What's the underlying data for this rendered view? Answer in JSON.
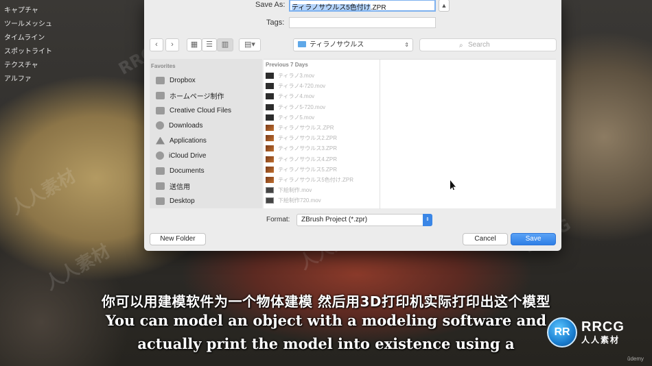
{
  "left_menu": {
    "items": [
      "キャプチャ",
      "ツールメッシュ",
      "タイムライン",
      "スポットライト",
      "テクスチャ",
      "アルファ"
    ]
  },
  "dialog": {
    "save_as_label": "Save As:",
    "save_as_selected": "ティラノサウルス5色付け",
    "save_as_ext": ".ZPR",
    "tags_label": "Tags:",
    "expand_icon": "chevron-up-icon",
    "location": "ティラノサウルス",
    "search_placeholder": "Search",
    "sidebar": {
      "heading": "Favorites",
      "items": [
        "Dropbox",
        "ホームページ制作",
        "Creative Cloud Files",
        "Downloads",
        "Applications",
        "iCloud Drive",
        "Documents",
        "送信用",
        "Desktop"
      ]
    },
    "column": {
      "heading": "Previous 7 Days",
      "files": [
        {
          "name": "ティラノ3.mov",
          "type": "mov"
        },
        {
          "name": "ティラノ4-720.mov",
          "type": "mov"
        },
        {
          "name": "ティラノ4.mov",
          "type": "mov"
        },
        {
          "name": "ティラノ5-720.mov",
          "type": "mov"
        },
        {
          "name": "ティラノ5.mov",
          "type": "mov"
        },
        {
          "name": "ティラノサウルス.ZPR",
          "type": "zpr"
        },
        {
          "name": "ティラノサウルス2.ZPR",
          "type": "zpr"
        },
        {
          "name": "ティラノサウルス3.ZPR",
          "type": "zpr"
        },
        {
          "name": "ティラノサウルス4.ZPR",
          "type": "zpr"
        },
        {
          "name": "ティラノサウルス5.ZPR",
          "type": "zpr"
        },
        {
          "name": "ティラノサウルス5色付け.ZPR",
          "type": "zpr"
        },
        {
          "name": "下絵制作.mov",
          "type": "mov2"
        },
        {
          "name": "下絵制作720.mov",
          "type": "mov2"
        }
      ]
    },
    "format_label": "Format:",
    "format_value": "ZBrush Project (*.zpr)",
    "new_folder_label": "New Folder",
    "cancel_label": "Cancel",
    "save_label": "Save"
  },
  "subtitles": {
    "cn": "你可以用建模软件为一个物体建模 然后用3D打印机实际打印出这个模型",
    "en_line1": "You can model an object with a modeling software and",
    "en_line2": "actually print the model into existence using a"
  },
  "watermark": {
    "rrcg": "RRCG",
    "cn": "人人素材"
  },
  "logo": {
    "mark": "RR",
    "text1": "RRCG",
    "text2": "人人素材"
  },
  "udemy": "ûdemy"
}
